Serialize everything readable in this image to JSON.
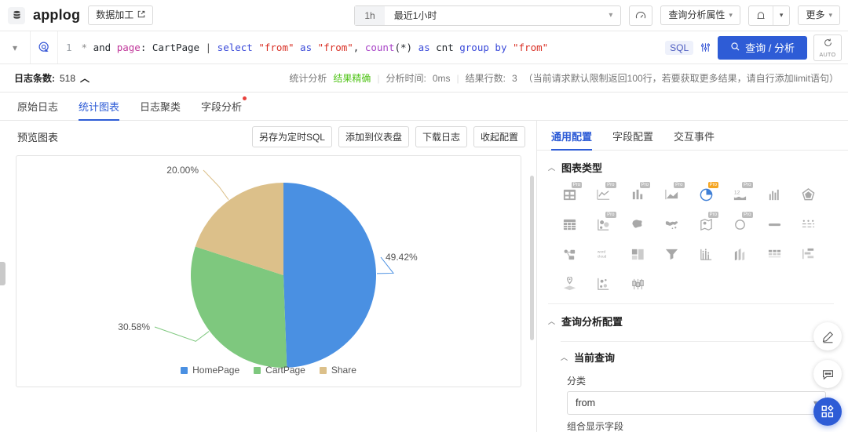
{
  "header": {
    "db_icon": "database-icon",
    "app_title": "applog",
    "data_process_button": "数据加工",
    "time_badge": "1h",
    "time_label": "最近1小时",
    "gauge_icon": "gauge-icon",
    "query_attr_button": "查询分析属性",
    "bell_icon": "bell-icon",
    "more_button": "更多"
  },
  "query": {
    "line_number": "1",
    "tokens": [
      {
        "t": "*",
        "c": "tok-star"
      },
      {
        "t": "and",
        "c": "tok-plain"
      },
      {
        "t": "page",
        "c": "tok-field"
      },
      {
        "t": ":",
        "c": "tok-plain"
      },
      {
        "t": "CartPage",
        "c": "tok-plain"
      },
      {
        "t": "|",
        "c": "tok-pipe"
      },
      {
        "t": "select",
        "c": "tok-key"
      },
      {
        "t": "\"from\"",
        "c": "tok-str"
      },
      {
        "t": "as",
        "c": "tok-key"
      },
      {
        "t": "\"from\"",
        "c": "tok-str"
      },
      {
        "t": ",",
        "c": "tok-plain"
      },
      {
        "t": "count",
        "c": "tok-fn"
      },
      {
        "t": "(*)",
        "c": "tok-plain"
      },
      {
        "t": "as",
        "c": "tok-key"
      },
      {
        "t": "cnt",
        "c": "tok-plain"
      },
      {
        "t": "group",
        "c": "tok-key"
      },
      {
        "t": "by",
        "c": "tok-key"
      },
      {
        "t": "\"from\"",
        "c": "tok-str"
      }
    ],
    "sql_badge": "SQL",
    "run_button": "查询 / 分析",
    "auto_label": "AUTO"
  },
  "stats": {
    "log_count_label": "日志条数:",
    "log_count_value": "518",
    "analysis_type": "统计分析",
    "accuracy": "结果精确",
    "time_label": "分析时间:",
    "time_value": "0ms",
    "rows_label": "结果行数:",
    "rows_value": "3",
    "rows_note": "（当前请求默认限制返回100行，若要获取更多结果，请自行添加limit语句）"
  },
  "tabs": [
    {
      "label": "原始日志",
      "active": false,
      "badge": false
    },
    {
      "label": "统计图表",
      "active": true,
      "badge": false
    },
    {
      "label": "日志聚类",
      "active": false,
      "badge": false
    },
    {
      "label": "字段分析",
      "active": false,
      "badge": true
    }
  ],
  "chart_panel": {
    "title": "预览图表",
    "buttons": [
      "另存为定时SQL",
      "添加到仪表盘",
      "下载日志",
      "收起配置"
    ]
  },
  "chart_data": {
    "type": "pie",
    "title": "",
    "categories": [
      "HomePage",
      "CartPage",
      "Share"
    ],
    "values": [
      49.42,
      30.58,
      20.0
    ],
    "labels": [
      "49.42%",
      "30.58%",
      "20.00%"
    ],
    "colors": [
      "#4a90e2",
      "#7ec87e",
      "#dcc08a"
    ],
    "legend_position": "bottom",
    "start_angle_deg": 0,
    "direction": "clockwise"
  },
  "config_panel": {
    "tabs": [
      {
        "label": "通用配置",
        "active": true
      },
      {
        "label": "字段配置",
        "active": false
      },
      {
        "label": "交互事件",
        "active": false
      }
    ],
    "chart_type_section": "图表类型",
    "chart_type_icons": [
      {
        "name": "table-kpi-icon",
        "pro": true,
        "selected": false
      },
      {
        "name": "line-chart-icon",
        "pro": true,
        "selected": false
      },
      {
        "name": "bar-chart-icon",
        "pro": true,
        "selected": false
      },
      {
        "name": "area-chart-icon",
        "pro": true,
        "selected": false
      },
      {
        "name": "pie-chart-icon",
        "pro": true,
        "selected": true
      },
      {
        "name": "number-trend-icon",
        "pro": true,
        "selected": false
      },
      {
        "name": "histogram-icon",
        "pro": false,
        "selected": false
      },
      {
        "name": "polygon-radar-icon",
        "pro": false,
        "selected": false
      },
      {
        "name": "grid-table-icon",
        "pro": false,
        "selected": false
      },
      {
        "name": "bubble-chart-icon",
        "pro": true,
        "selected": false
      },
      {
        "name": "china-map-icon",
        "pro": false,
        "selected": false
      },
      {
        "name": "world-map-icon",
        "pro": false,
        "selected": false
      },
      {
        "name": "map-marker-icon",
        "pro": true,
        "selected": false
      },
      {
        "name": "gauge-chart-icon",
        "pro": true,
        "selected": false
      },
      {
        "name": "progress-bar-icon",
        "pro": false,
        "selected": false
      },
      {
        "name": "list-dots-icon",
        "pro": false,
        "selected": false
      },
      {
        "name": "relation-graph-icon",
        "pro": false,
        "selected": false
      },
      {
        "name": "word-cloud-icon",
        "pro": false,
        "selected": false
      },
      {
        "name": "treemap-icon",
        "pro": false,
        "selected": false
      },
      {
        "name": "funnel-chart-icon",
        "pro": false,
        "selected": false
      },
      {
        "name": "scatter-column-icon",
        "pro": false,
        "selected": false
      },
      {
        "name": "column-3d-icon",
        "pro": false,
        "selected": false
      },
      {
        "name": "data-table-icon",
        "pro": false,
        "selected": false
      },
      {
        "name": "flow-diagram-icon",
        "pro": false,
        "selected": false
      },
      {
        "name": "geo-point-icon",
        "pro": false,
        "selected": false
      },
      {
        "name": "scatter-plot-icon",
        "pro": false,
        "selected": false
      },
      {
        "name": "box-plot-icon",
        "pro": false,
        "selected": false
      }
    ],
    "query_config_section": "查询分析配置",
    "current_query_section": "当前查询",
    "category_label": "分类",
    "category_value": "from",
    "combine_field_label": "组合显示字段"
  },
  "fabs": [
    {
      "name": "edit-pencil-icon",
      "primary": false
    },
    {
      "name": "feedback-chat-icon",
      "primary": false
    },
    {
      "name": "apps-grid-icon",
      "primary": true
    }
  ]
}
